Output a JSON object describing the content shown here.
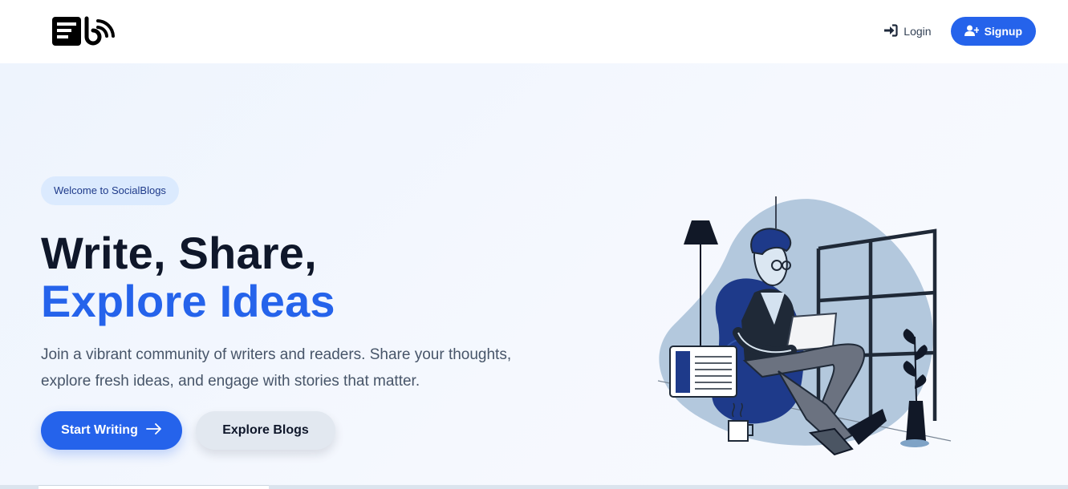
{
  "nav": {
    "logo_icon": "blog-rss-logo-icon",
    "login_label": "Login",
    "login_icon": "sign-in-icon",
    "signup_label": "Signup",
    "signup_icon": "user-plus-icon"
  },
  "hero": {
    "badge": "Welcome to SocialBlogs",
    "headline_line1": "Write, Share,",
    "headline_line2": "Explore Ideas",
    "description": "Join a vibrant community of writers and readers. Share your thoughts, explore fresh ideas, and engage with stories that matter.",
    "primary_button": "Start Writing",
    "primary_button_icon": "arrow-right-icon",
    "secondary_button": "Explore Blogs",
    "illustration": "man-reading-on-beanbag-illustration"
  },
  "colors": {
    "accent": "#2563eb",
    "badge_bg": "#dbeafe",
    "headline": "#0f172a",
    "body_text": "#475569"
  }
}
